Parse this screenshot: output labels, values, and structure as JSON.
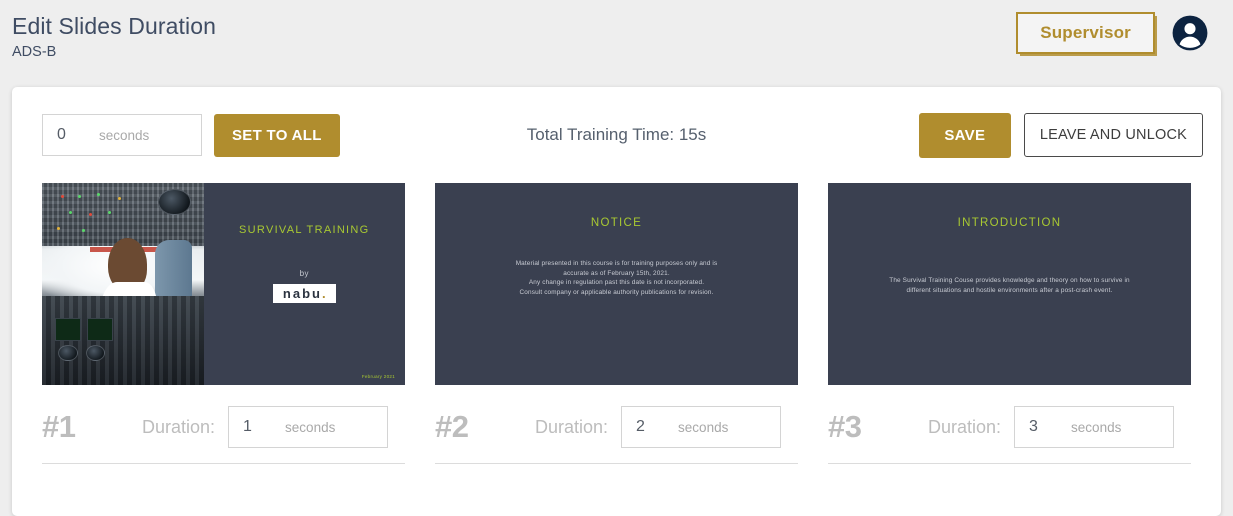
{
  "header": {
    "title": "Edit Slides Duration",
    "subtitle": "ADS-B",
    "role_badge": "Supervisor",
    "avatar_icon": "account-circle-icon"
  },
  "toolbar": {
    "bulk_duration_value": "0",
    "bulk_duration_unit": "seconds",
    "set_to_all_label": "SET TO ALL",
    "total_time": "Total Training Time: 15s",
    "save_label": "SAVE",
    "leave_label": "LEAVE AND UNLOCK"
  },
  "colors": {
    "accent_gold": "#b08d2e",
    "slide_bg": "#3a4050",
    "slide_heading": "#a8c832",
    "page_bg": "#eeeeee",
    "title_text": "#3f4c63",
    "muted_text": "#bdbdbd"
  },
  "slides": [
    {
      "number": "#1",
      "duration_label": "Duration:",
      "duration_value": "1",
      "duration_unit": "seconds",
      "thumb": {
        "layout": "photo-left",
        "heading": "SURVIVAL TRAINING",
        "byline": "by",
        "logo": "nabu",
        "date": "February 2021"
      }
    },
    {
      "number": "#2",
      "duration_label": "Duration:",
      "duration_value": "2",
      "duration_unit": "seconds",
      "thumb": {
        "layout": "full",
        "heading": "NOTICE",
        "body_line1": "Material presented in this course is for training purposes only and is",
        "body_line2": "accurate as of February 15th, 2021.",
        "body_line3": "Any change in regulation past this date is not incorporated.",
        "body_line4": "Consult company or applicable authority publications for revision."
      }
    },
    {
      "number": "#3",
      "duration_label": "Duration:",
      "duration_value": "3",
      "duration_unit": "seconds",
      "thumb": {
        "layout": "full",
        "heading": "INTRODUCTION",
        "body_line1": "The Survival Training Couse provides knowledge and theory on how to survive in",
        "body_line2": "different situations and hostile environments after a post-crash event."
      }
    }
  ]
}
